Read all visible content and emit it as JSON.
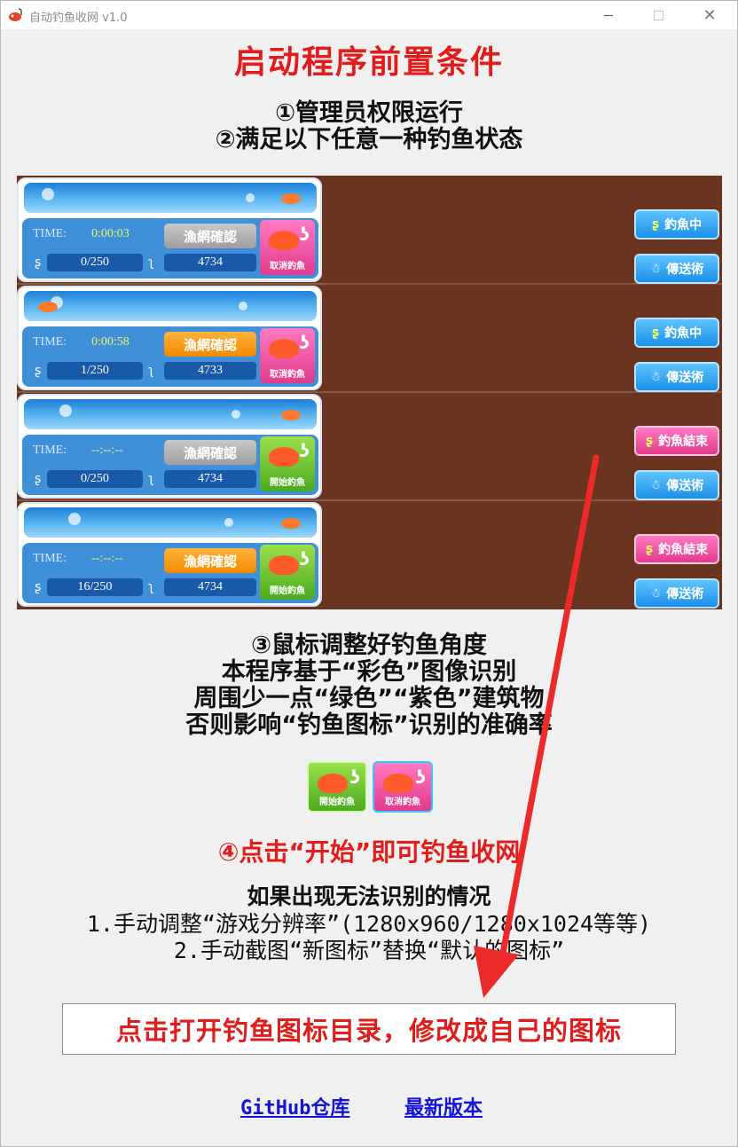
{
  "window": {
    "title": "自动钓鱼收网 v1.0",
    "minimize": "",
    "maximize": "",
    "close": "✕"
  },
  "heading": "启动程序前置条件",
  "steps": {
    "s1": "①管理员权限运行",
    "s2": "②满足以下任意一种钓鱼状态",
    "s3": "③鼠标调整好钓鱼角度",
    "s3_l2": "本程序基于“彩色”图像识别",
    "s3_l3": "周围少一点“绿色”“紫色”建筑物",
    "s3_l4": "否则影响“钓鱼图标”识别的准确率",
    "s4": "④点击“开始”即可钓鱼收网"
  },
  "game_states": [
    {
      "time_label": "TIME:",
      "time": "0:00:03",
      "net_label": "漁網確認",
      "net_active": false,
      "count": "0/250",
      "points": "4734",
      "fish_btn": "取消釣魚",
      "fish_btn_color": "pink",
      "status_btn": "釣魚中",
      "status_color": "blue",
      "teleport": "傳送術"
    },
    {
      "time_label": "TIME:",
      "time": "0:00:58",
      "net_label": "漁網確認",
      "net_active": true,
      "count": "1/250",
      "points": "4733",
      "fish_btn": "取消釣魚",
      "fish_btn_color": "pink",
      "status_btn": "釣魚中",
      "status_color": "blue",
      "teleport": "傳送術"
    },
    {
      "time_label": "TIME:",
      "time": "--:--:--",
      "net_label": "漁網確認",
      "net_active": false,
      "count": "0/250",
      "points": "4734",
      "fish_btn": "開始釣魚",
      "fish_btn_color": "green",
      "status_btn": "釣魚結束",
      "status_color": "pink",
      "teleport": "傳送術"
    },
    {
      "time_label": "TIME:",
      "time": "--:--:--",
      "net_label": "漁網確認",
      "net_active": true,
      "count": "16/250",
      "points": "4734",
      "fish_btn": "開始釣魚",
      "fish_btn_color": "green",
      "status_btn": "釣魚結束",
      "status_color": "pink",
      "teleport": "傳送術"
    }
  ],
  "icons": {
    "start": "開始釣魚",
    "cancel": "取消釣魚"
  },
  "troubleshoot": {
    "l1": "如果出现无法识别的情况",
    "l2": "1.手动调整“游戏分辨率”(1280x960/1280x1024等等)",
    "l3": "2.手动截图“新图标”替换“默认的图标”"
  },
  "open_button": "点击打开钓鱼图标目录，修改成自己的图标",
  "links": {
    "github": "GitHub仓库",
    "latest": "最新版本"
  },
  "colors": {
    "accent_red": "#e21b1b",
    "link_blue": "#1414d8",
    "game_bg": "#6b3420"
  }
}
